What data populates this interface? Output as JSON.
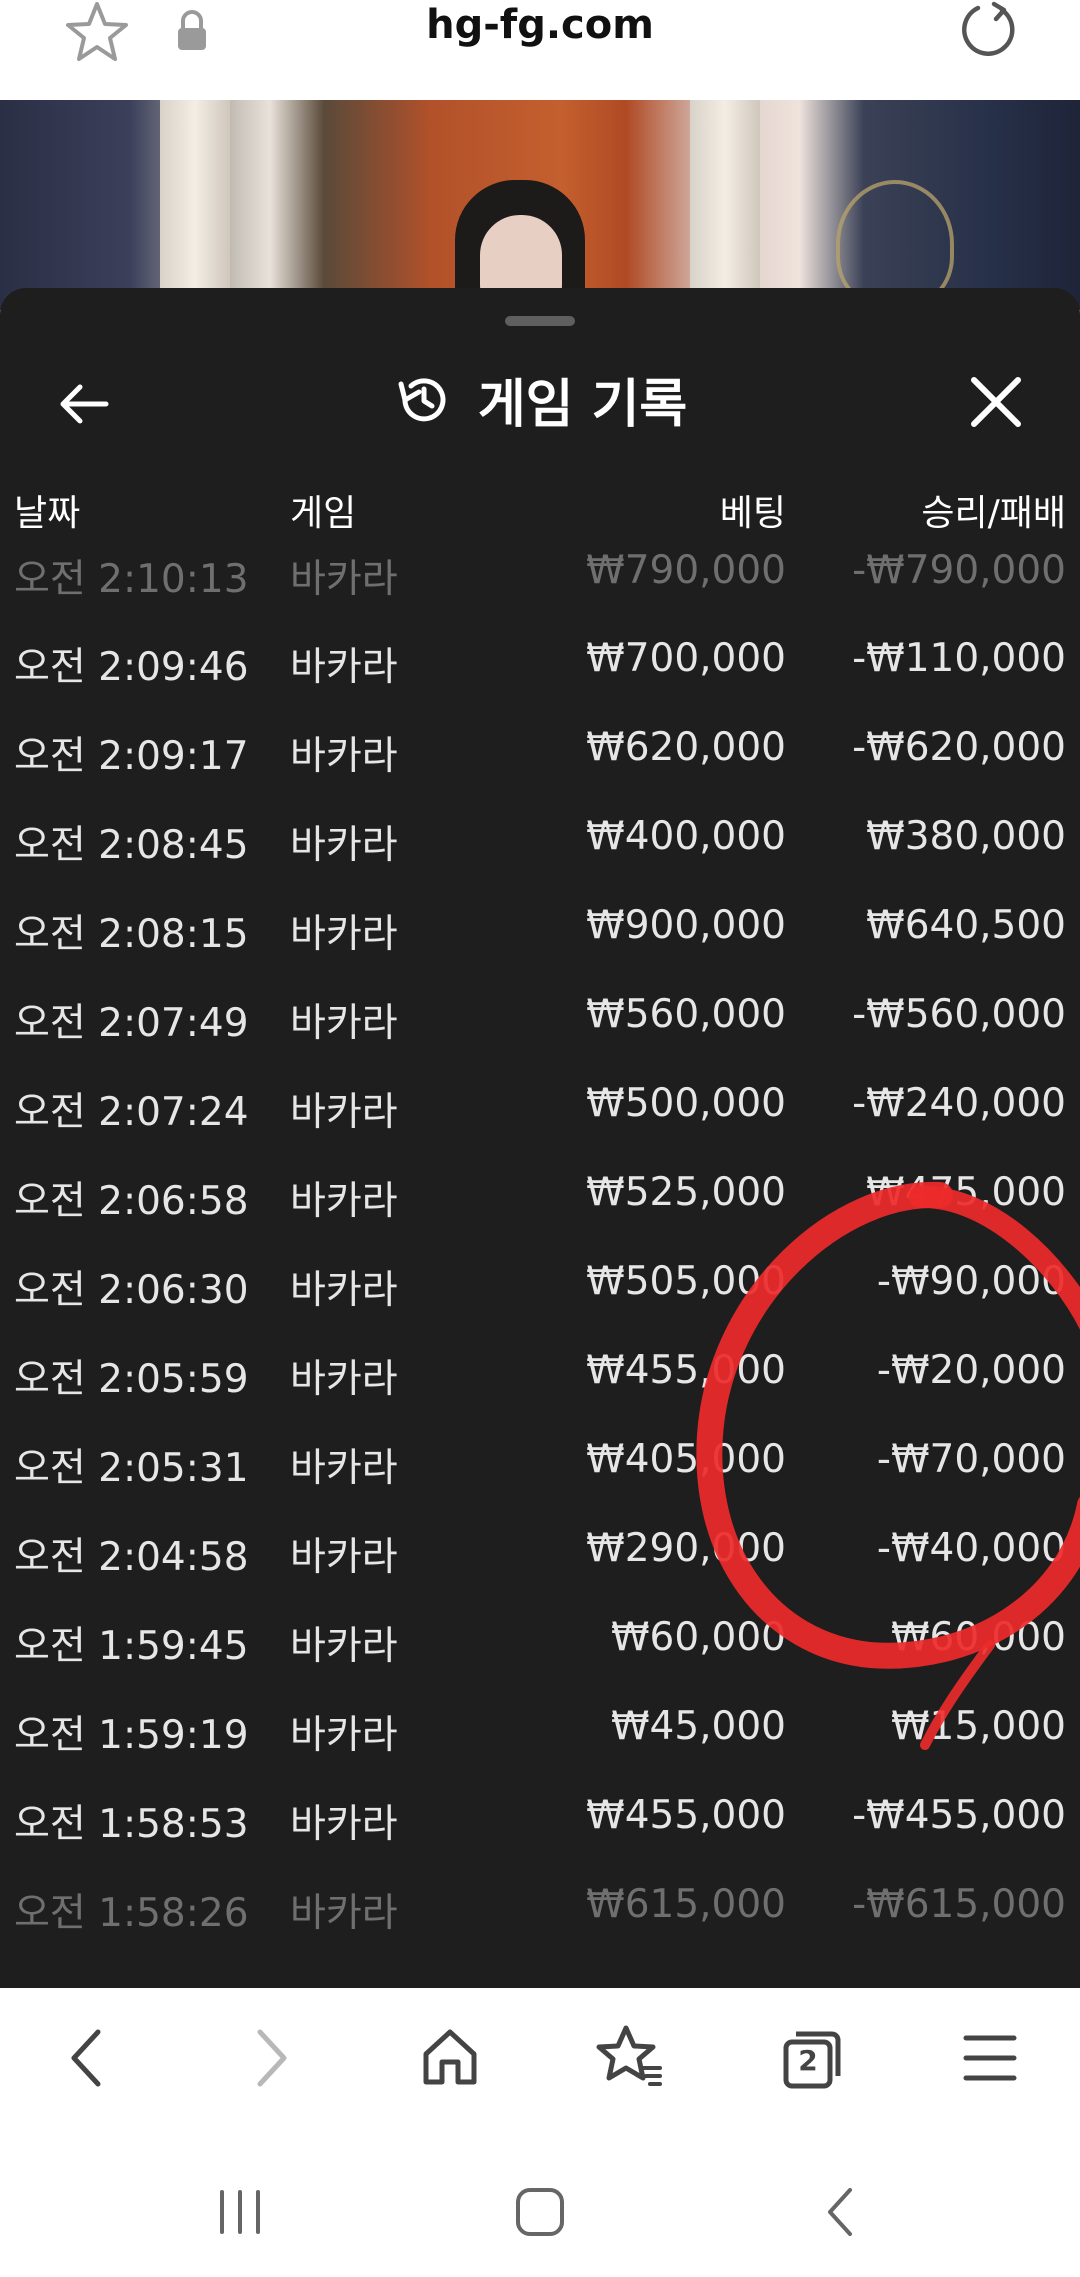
{
  "browser": {
    "url": "hg-fg.com",
    "icons": [
      "star-icon",
      "lock-icon",
      "reload-icon"
    ]
  },
  "panel": {
    "title": "게임 기록",
    "columns": [
      "날짜",
      "게임",
      "베팅",
      "승리/패배"
    ],
    "rows": [
      {
        "time": "오전 2:10:13",
        "game": "바카라",
        "bet": "₩790,000",
        "result": "-₩790,000"
      },
      {
        "time": "오전 2:09:46",
        "game": "바카라",
        "bet": "₩700,000",
        "result": "-₩110,000"
      },
      {
        "time": "오전 2:09:17",
        "game": "바카라",
        "bet": "₩620,000",
        "result": "-₩620,000"
      },
      {
        "time": "오전 2:08:45",
        "game": "바카라",
        "bet": "₩400,000",
        "result": "₩380,000"
      },
      {
        "time": "오전 2:08:15",
        "game": "바카라",
        "bet": "₩900,000",
        "result": "₩640,500"
      },
      {
        "time": "오전 2:07:49",
        "game": "바카라",
        "bet": "₩560,000",
        "result": "-₩560,000"
      },
      {
        "time": "오전 2:07:24",
        "game": "바카라",
        "bet": "₩500,000",
        "result": "-₩240,000"
      },
      {
        "time": "오전 2:06:58",
        "game": "바카라",
        "bet": "₩525,000",
        "result": "₩475,000"
      },
      {
        "time": "오전 2:06:30",
        "game": "바카라",
        "bet": "₩505,000",
        "result": "-₩90,000"
      },
      {
        "time": "오전 2:05:59",
        "game": "바카라",
        "bet": "₩455,000",
        "result": "-₩20,000"
      },
      {
        "time": "오전 2:05:31",
        "game": "바카라",
        "bet": "₩405,000",
        "result": "-₩70,000"
      },
      {
        "time": "오전 2:04:58",
        "game": "바카라",
        "bet": "₩290,000",
        "result": "-₩40,000"
      },
      {
        "time": "오전 1:59:45",
        "game": "바카라",
        "bet": "₩60,000",
        "result": "₩60,000"
      },
      {
        "time": "오전 1:59:19",
        "game": "바카라",
        "bet": "₩45,000",
        "result": "₩15,000"
      },
      {
        "time": "오전 1:58:53",
        "game": "바카라",
        "bet": "₩455,000",
        "result": "-₩455,000"
      },
      {
        "time": "오전 1:58:26",
        "game": "바카라",
        "bet": "₩615,000",
        "result": "-₩615,000"
      }
    ]
  },
  "bottom_nav": [
    "back-icon",
    "forward-icon",
    "home-icon",
    "bookmarks-icon",
    "tabs-icon",
    "menu-icon"
  ],
  "tabs_count": "2",
  "system_nav": [
    "recents-icon",
    "home-button-icon",
    "system-back-icon"
  ],
  "colors": {
    "panel_bg": "#1e1e1e",
    "text": "#e6e6e6",
    "faded_text": "#6f6f6f",
    "annotation": "#ee2a2a"
  }
}
